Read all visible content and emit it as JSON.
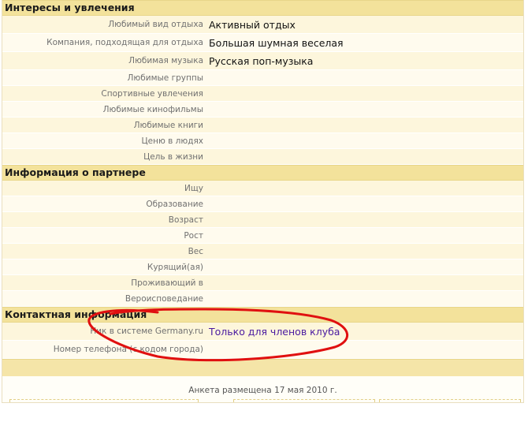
{
  "sections": {
    "interests": {
      "title": "Интересы и увлечения",
      "rows": [
        {
          "label": "Любимый вид отдыха",
          "value": "Активный отдых"
        },
        {
          "label": "Компания, подходящая для отдыха",
          "value": "Большая шумная веселая"
        },
        {
          "label": "Любимая музыка",
          "value": "Русская поп-музыка"
        },
        {
          "label": "Любимые группы",
          "value": ""
        },
        {
          "label": "Спортивные увлечения",
          "value": ""
        },
        {
          "label": "Любимые кинофильмы",
          "value": ""
        },
        {
          "label": "Любимые книги",
          "value": ""
        },
        {
          "label": "Ценю в людях",
          "value": ""
        },
        {
          "label": "Цель в жизни",
          "value": ""
        }
      ]
    },
    "partner": {
      "title": "Информация о партнере",
      "rows": [
        {
          "label": "Ищу",
          "value": ""
        },
        {
          "label": "Образование",
          "value": ""
        },
        {
          "label": "Возраст",
          "value": ""
        },
        {
          "label": "Рост",
          "value": ""
        },
        {
          "label": "Вес",
          "value": ""
        },
        {
          "label": "Курящий(ая)",
          "value": ""
        },
        {
          "label": "Проживающий в",
          "value": ""
        },
        {
          "label": "Вероисповедание",
          "value": ""
        }
      ]
    },
    "contact": {
      "title": "Контактная информация",
      "rows": [
        {
          "label": "Ник в системе Germany.ru",
          "value": "Только для членов клуба"
        },
        {
          "label": "Номер телефона (с кодом города)",
          "value": ""
        }
      ]
    }
  },
  "footer": {
    "posted_text": "Анкета размещена 17 мая 2010 г."
  },
  "colors": {
    "header_bg": "#f3e29b",
    "row_odd": "#fdf6dc",
    "row_even": "#fffbee",
    "link": "#4a1aa0",
    "annotation_circle": "#e01010"
  }
}
